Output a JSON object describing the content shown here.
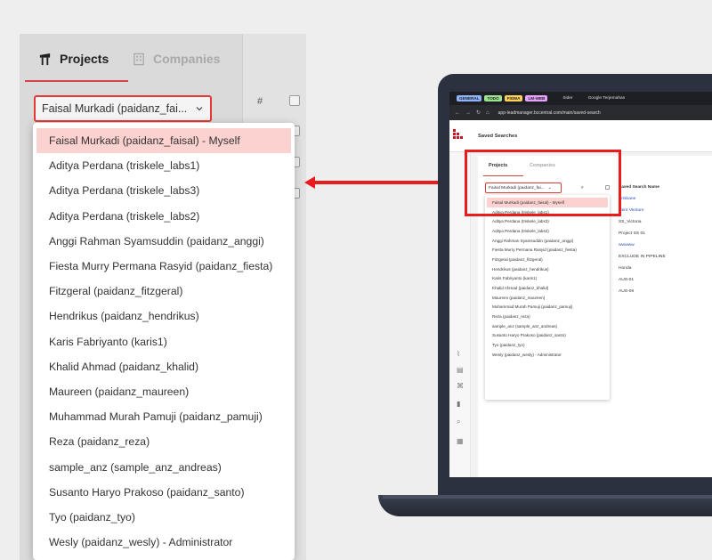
{
  "zoom": {
    "tabs": {
      "projects": "Projects",
      "companies": "Companies"
    },
    "selected_user": "Faisal Murkadi (paidanz_fai...",
    "hash": "#",
    "dropdown_items": [
      "Faisal Murkadi (paidanz_faisal) - Myself",
      "Aditya Perdana (triskele_labs1)",
      "Aditya Perdana (triskele_labs3)",
      "Aditya Perdana (triskele_labs2)",
      "Anggi Rahman Syamsuddin (paidanz_anggi)",
      "Fiesta Murry Permana Rasyid (paidanz_fiesta)",
      "Fitzgeral (paidanz_fitzgeral)",
      "Hendrikus (paidanz_hendrikus)",
      "Karis Fabriyanto (karis1)",
      "Khalid Ahmad (paidanz_khalid)",
      "Maureen (paidanz_maureen)",
      "Muhammad Murah Pamuji (paidanz_pamuji)",
      "Reza (paidanz_reza)",
      "sample_anz (sample_anz_andreas)",
      "Susanto Haryo Prakoso (paidanz_santo)",
      "Tyo (paidanz_tyo)",
      "Wesly (paidanz_wesly) - Administrator"
    ]
  },
  "laptop": {
    "browser_tabs": [
      "GENERAL",
      "TODO",
      "FIGMA",
      "LM-WEB"
    ],
    "browser_tab_colors": [
      "#8fb3ff",
      "#9be38f",
      "#ffd15c",
      "#e7a3ff"
    ],
    "sider_tab": "Sider",
    "google_tab": "Google Terjemahan",
    "url": "app-leadmanager.bccentral.com/main/saved-search",
    "app_title": "Saved Searches",
    "tabs": {
      "projects": "Projects",
      "companies": "Companies"
    },
    "selected_user": "Faisal Murkadi (paidanz_fai...",
    "hash": "#",
    "column_header": "Saved Search Name",
    "rows": [
      {
        "name": "Brisbane",
        "link": true
      },
      {
        "name": "Joint Venture",
        "link": true
      },
      {
        "name": "SS_Victoria",
        "link": false
      },
      {
        "name": "Project SS 01",
        "link": false
      },
      {
        "name": "wwwww",
        "link": true
      },
      {
        "name": "EXCLUDE IN PIPELINE",
        "link": false
      },
      {
        "name": "Honda",
        "link": false
      },
      {
        "name": "AUS-01",
        "link": false
      },
      {
        "name": "AUS-09",
        "link": false
      }
    ],
    "dropdown_items": [
      "Faisal Murkadi (paidanz_faisal) - Myself",
      "Aditya Perdana (triskele_labs1)",
      "Aditya Perdana (triskele_labs3)",
      "Aditya Perdana (triskele_labs2)",
      "Anggi Rahman Syamsuddin (paidanz_anggi)",
      "Fiesta Murry Permana Rasyid (paidanz_fiesta)",
      "Fitzgeral (paidanz_fitzgeral)",
      "Hendrikus (paidanz_hendrikus)",
      "Karis Fabriyanto (karis1)",
      "Khalid Ahmad (paidanz_khalid)",
      "Maureen (paidanz_maureen)",
      "Muhammad Murah Pamuji (paidanz_pamuji)",
      "Reza (paidanz_reza)",
      "sample_anz (sample_anz_andreas)",
      "Susanto Haryo Prakoso (paidanz_santo)",
      "Tyo (paidanz_tyo)",
      "Wesly (paidanz_wesly) - Administrator"
    ]
  },
  "colors": {
    "accent": "#e81c1c",
    "selected_bg": "#fbd2cf"
  }
}
